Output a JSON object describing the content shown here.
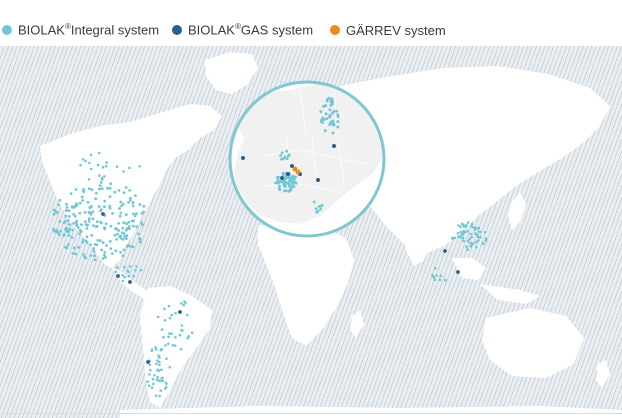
{
  "legend": {
    "items": [
      {
        "name_prefix": "BIOLAK",
        "name_sup": "®",
        "name_suffix": "Integral system",
        "color": "#71c7d4"
      },
      {
        "name_prefix": "BIOLAK",
        "name_sup": "®",
        "name_suffix": "GAS system",
        "color": "#2f5e86"
      },
      {
        "name_prefix": "GÄRREV system",
        "name_sup": "",
        "name_suffix": "",
        "color": "#f08a1c"
      }
    ]
  },
  "map": {
    "background_color": "#eaeef1",
    "hatch_color": "#7f95aa",
    "land_color": "#ffffff",
    "inset": {
      "ring_color": "#7fc8d2",
      "land_color": "#f1f1f1",
      "region": "Europe"
    }
  }
}
